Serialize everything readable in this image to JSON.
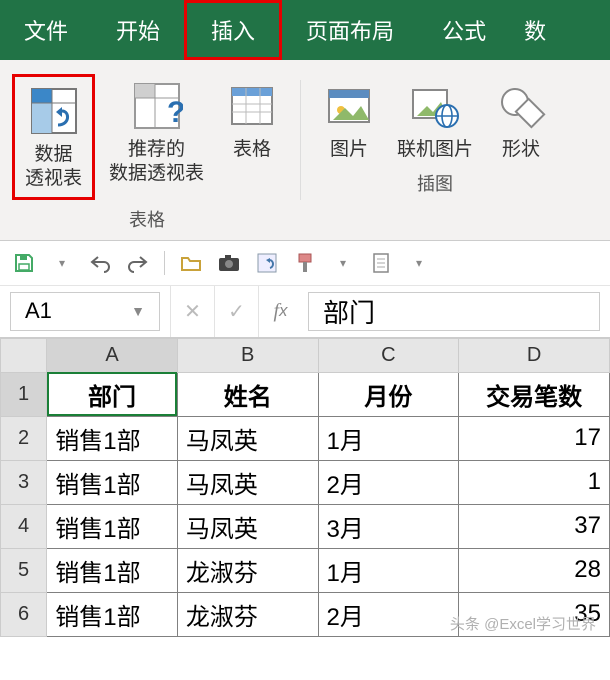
{
  "menu": {
    "file": "文件",
    "home": "开始",
    "insert": "插入",
    "layout": "页面布局",
    "formula": "公式",
    "data_frag": "数"
  },
  "ribbon": {
    "pivot": "数据\n透视表",
    "recommended_pivot": "推荐的\n数据透视表",
    "table": "表格",
    "group_tables": "表格",
    "picture": "图片",
    "online_picture": "联机图片",
    "shapes": "形状",
    "group_illustrations": "插图"
  },
  "qat": {},
  "namebox": "A1",
  "formula_value": "部门",
  "sheet": {
    "cols": [
      "A",
      "B",
      "C",
      "D"
    ],
    "rows": [
      "1",
      "2",
      "3",
      "4",
      "5",
      "6"
    ],
    "headers": {
      "dept": "部门",
      "name": "姓名",
      "month": "月份",
      "count": "交易笔数"
    },
    "data": [
      {
        "dept": "销售1部",
        "name": "马凤英",
        "month": "1月",
        "count": "17"
      },
      {
        "dept": "销售1部",
        "name": "马凤英",
        "month": "2月",
        "count": "1"
      },
      {
        "dept": "销售1部",
        "name": "马凤英",
        "month": "3月",
        "count": "37"
      },
      {
        "dept": "销售1部",
        "name": "龙淑芬",
        "month": "1月",
        "count": "28"
      },
      {
        "dept": "销售1部",
        "name": "龙淑芬",
        "month": "2月",
        "count": "35"
      }
    ]
  },
  "watermark": "头条 @Excel学习世界",
  "chart_data": {
    "type": "table",
    "title": "",
    "columns": [
      "部门",
      "姓名",
      "月份",
      "交易笔数"
    ],
    "rows": [
      [
        "销售1部",
        "马凤英",
        "1月",
        17
      ],
      [
        "销售1部",
        "马凤英",
        "2月",
        1
      ],
      [
        "销售1部",
        "马凤英",
        "3月",
        37
      ],
      [
        "销售1部",
        "龙淑芬",
        "1月",
        28
      ],
      [
        "销售1部",
        "龙淑芬",
        "2月",
        35
      ]
    ]
  }
}
